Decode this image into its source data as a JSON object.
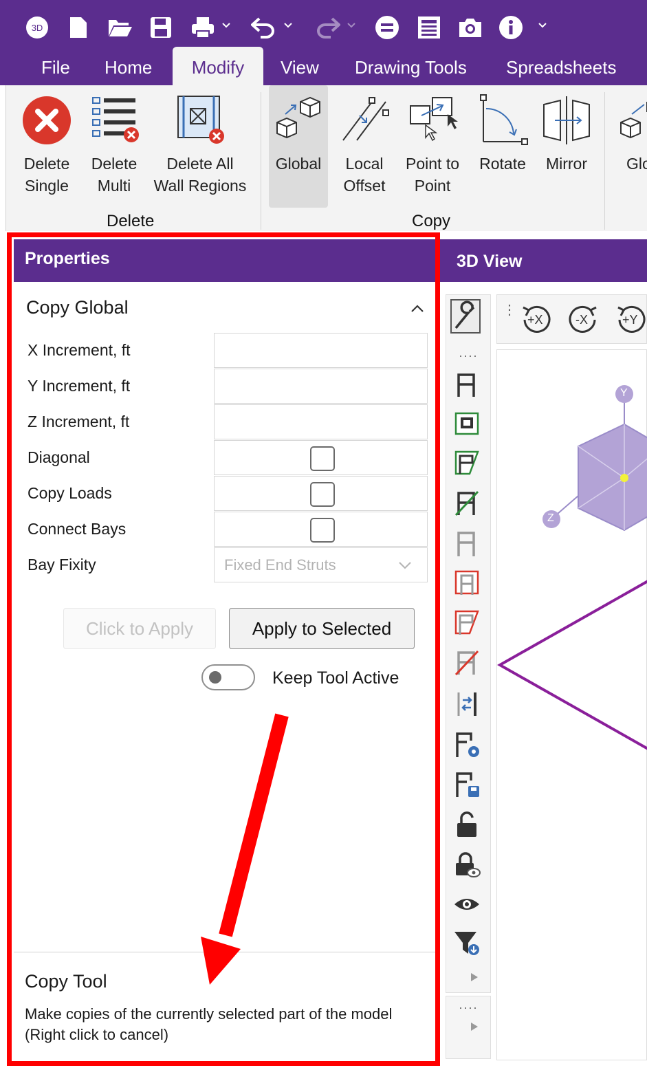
{
  "quick_access": {
    "icons": [
      "3d-logo-icon",
      "new-file-icon",
      "open-folder-icon",
      "save-icon",
      "print-icon",
      "undo-icon",
      "redo-icon",
      "equals-icon",
      "report-icon",
      "camera-icon",
      "info-icon"
    ]
  },
  "menu": {
    "tabs": [
      {
        "label": "File"
      },
      {
        "label": "Home"
      },
      {
        "label": "Modify",
        "active": true
      },
      {
        "label": "View"
      },
      {
        "label": "Drawing Tools"
      },
      {
        "label": "Spreadsheets"
      }
    ]
  },
  "ribbon": {
    "delete_group": {
      "label": "Delete",
      "buttons": [
        {
          "line1": "Delete",
          "line2": "Single"
        },
        {
          "line1": "Delete",
          "line2": "Multi"
        },
        {
          "line1": "Delete All",
          "line2": "Wall Regions"
        }
      ]
    },
    "copy_group": {
      "label": "Copy",
      "buttons": [
        {
          "line1": "Global",
          "line2": "",
          "selected": true
        },
        {
          "line1": "Local",
          "line2": "Offset"
        },
        {
          "line1": "Point to",
          "line2": "Point"
        },
        {
          "line1": "Rotate",
          "line2": ""
        },
        {
          "line1": "Mirror",
          "line2": ""
        },
        {
          "line1": "Glol",
          "line2": ""
        }
      ]
    }
  },
  "properties": {
    "header": "Properties",
    "section_title": "Copy Global",
    "rows": [
      {
        "label": "X Increment, ft",
        "type": "text",
        "value": ""
      },
      {
        "label": "Y Increment, ft",
        "type": "text",
        "value": ""
      },
      {
        "label": "Z Increment, ft",
        "type": "text",
        "value": ""
      },
      {
        "label": "Diagonal",
        "type": "checkbox",
        "checked": false
      },
      {
        "label": "Copy Loads",
        "type": "checkbox",
        "checked": false
      },
      {
        "label": "Connect Bays",
        "type": "checkbox",
        "checked": false
      },
      {
        "label": "Bay Fixity",
        "type": "select",
        "value": "Fixed End Struts"
      }
    ],
    "click_to_apply_label": "Click to Apply",
    "apply_selected_label": "Apply to Selected",
    "keep_tool_active_label": "Keep Tool Active",
    "keep_tool_active_on": false,
    "footer_title": "Copy Tool",
    "footer_desc": "Make copies of the currently selected part of the model (Right click to cancel)"
  },
  "view_panel": {
    "header": "3D View",
    "rotate_buttons": [
      "+X",
      "-X",
      "+Y"
    ],
    "axis_labels": [
      "Y",
      "Z"
    ]
  },
  "colors": {
    "brand": "#5b2d8e",
    "highlight": "#ff0000",
    "delete_red": "#d9372b",
    "model_line": "#8a1f9a",
    "cube": "#b3a3d6"
  }
}
